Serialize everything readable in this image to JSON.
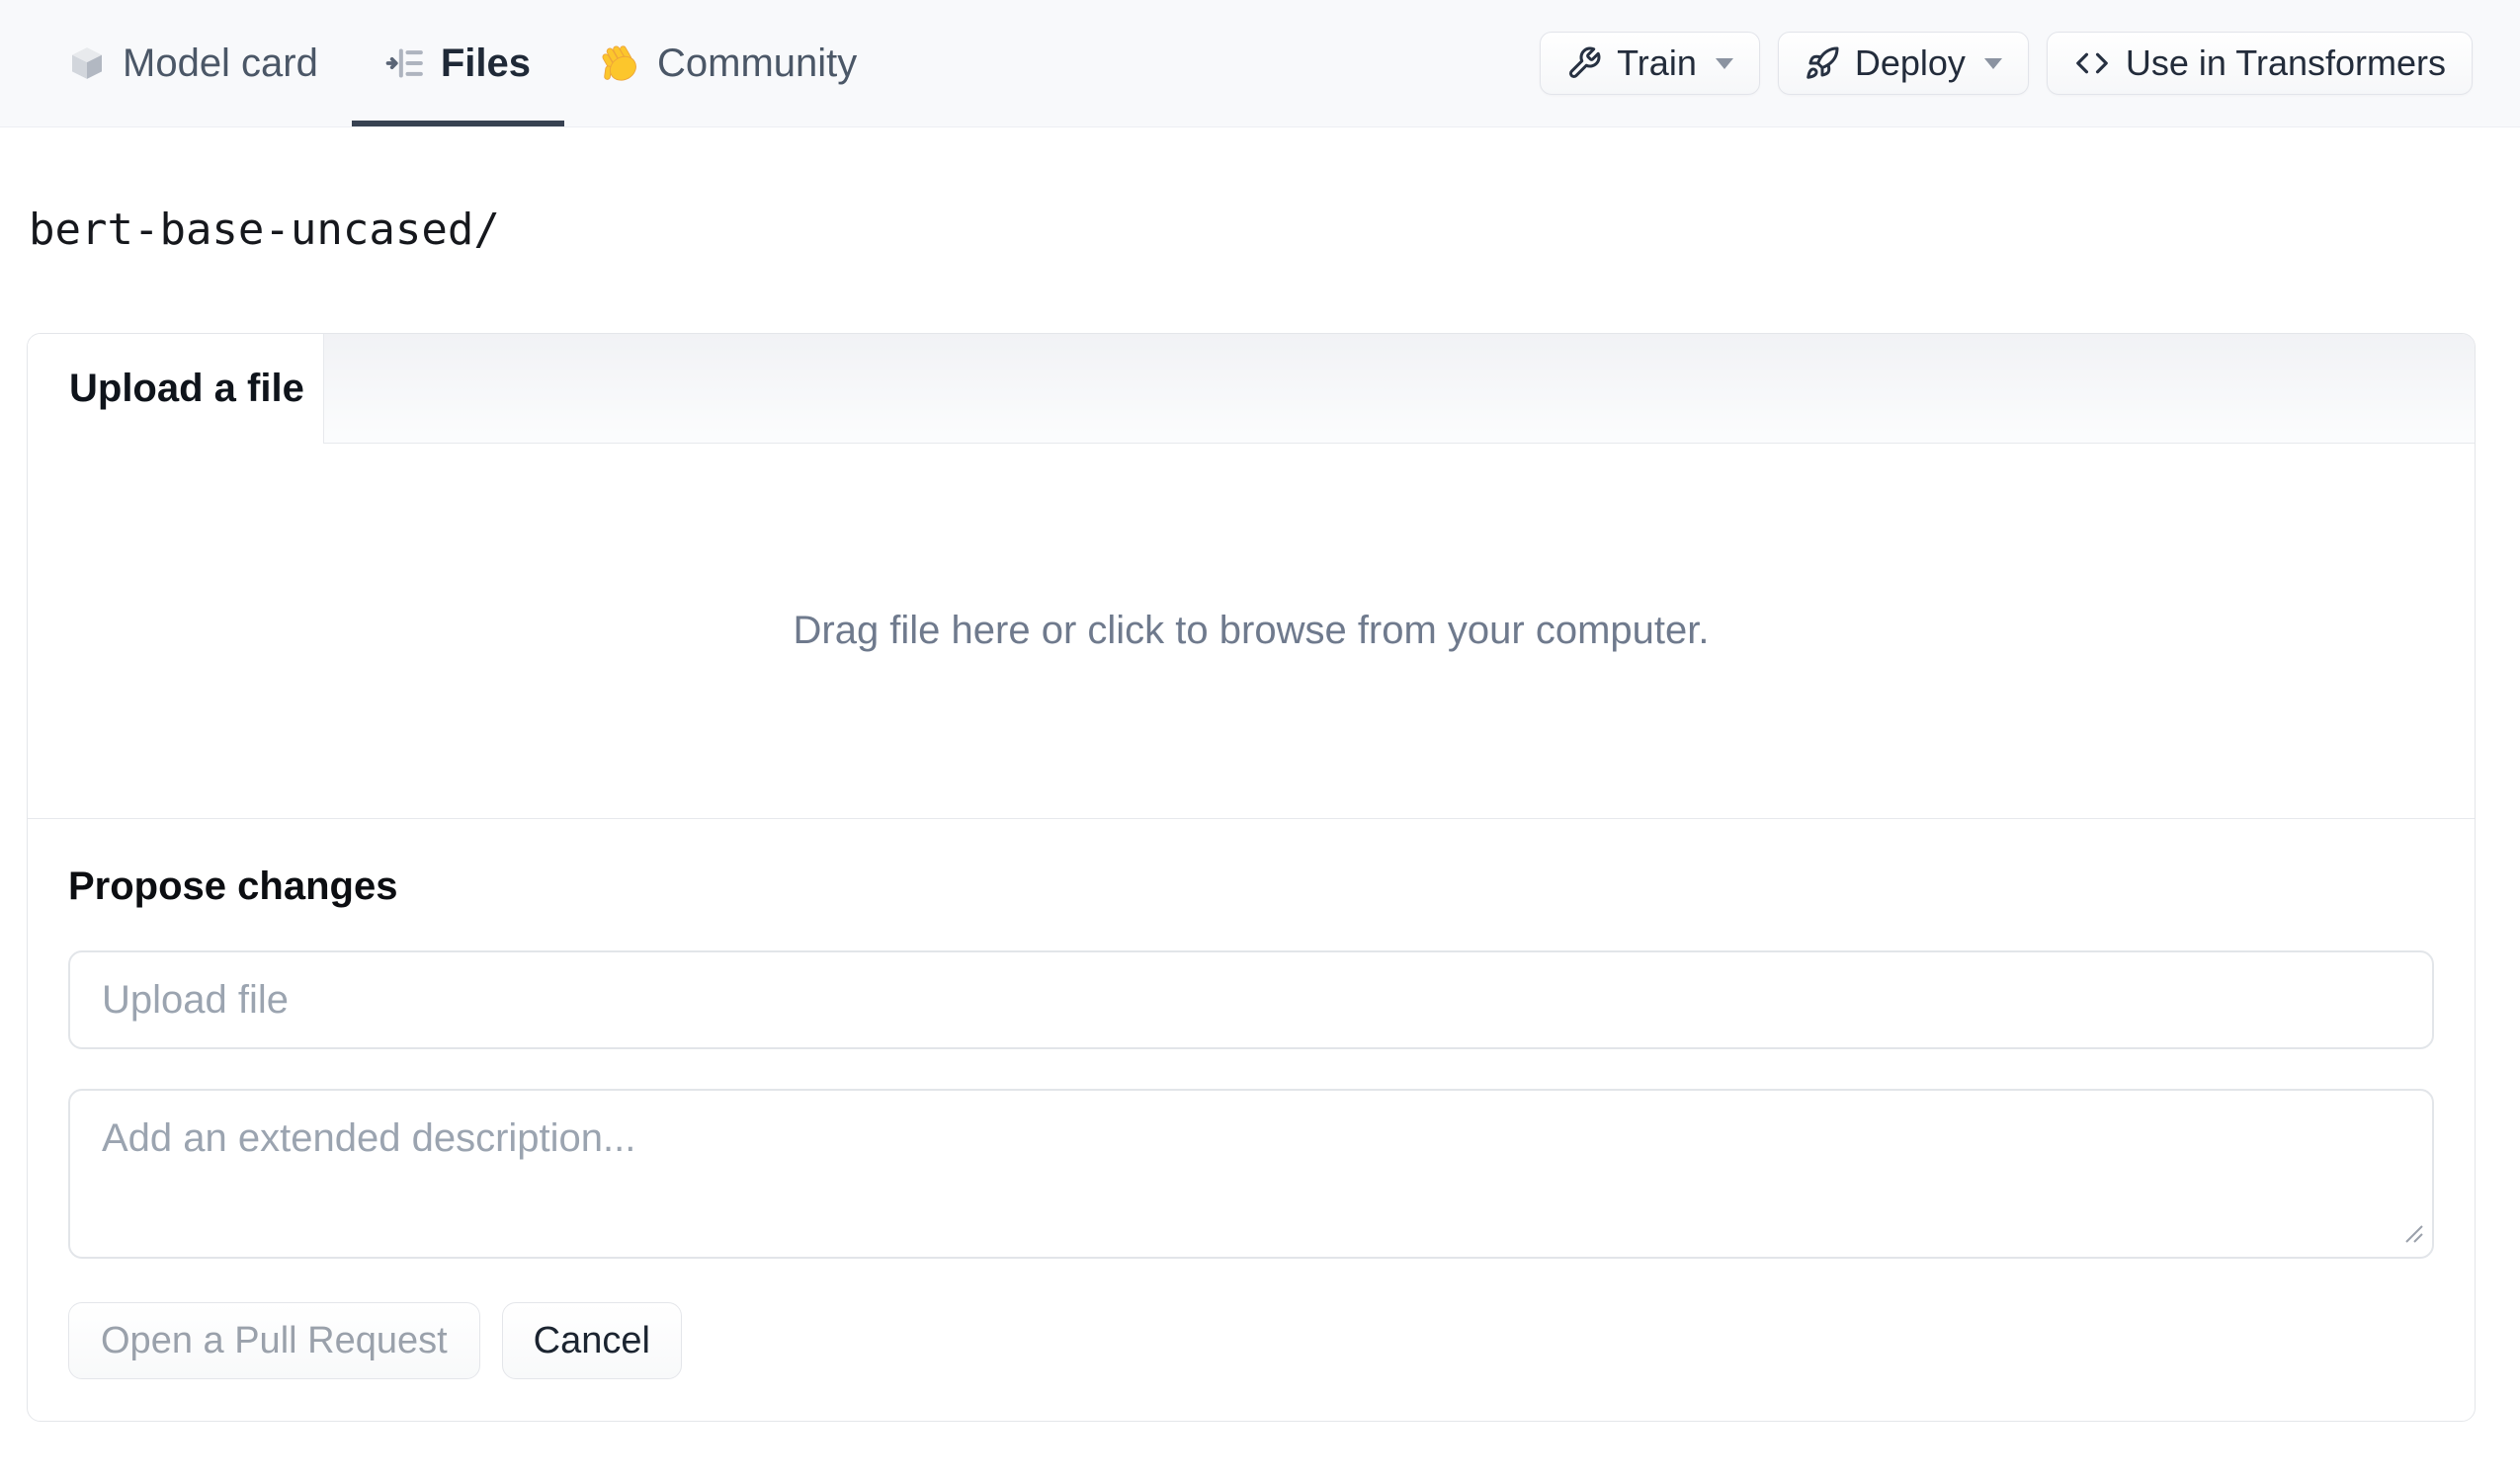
{
  "nav": {
    "tabs": [
      {
        "label": "Model card",
        "icon": "cube-icon",
        "active": false
      },
      {
        "label": "Files",
        "icon": "file-versions-icon",
        "active": true
      },
      {
        "label": "Community",
        "icon": "waving-hand-icon",
        "active": false
      }
    ],
    "actions": [
      {
        "label": "Train",
        "icon": "wrench-icon",
        "has_dropdown": true
      },
      {
        "label": "Deploy",
        "icon": "rocket-icon",
        "has_dropdown": true
      },
      {
        "label": "Use in Transformers",
        "icon": "code-icon",
        "has_dropdown": false
      }
    ]
  },
  "breadcrumb": {
    "path": "bert-base-uncased/"
  },
  "upload_panel": {
    "tab_label": "Upload a file",
    "dropzone_text": "Drag file here or click to browse from your computer.",
    "propose": {
      "heading": "Propose changes",
      "filename_placeholder": "Upload file",
      "filename_value": "",
      "description_placeholder": "Add an extended description...",
      "description_value": "",
      "primary_label": "Open a Pull Request",
      "cancel_label": "Cancel"
    }
  },
  "colors": {
    "navbar_bg": "#f8f9fb",
    "active_tab_underline": "#384252",
    "nav_text": "#4b5767",
    "panel_border": "#e4e6ea",
    "dropzone_text": "#6f7a8d",
    "placeholder": "#9ba4b0",
    "disabled_button_text": "#9aa1ab",
    "hand_emoji_yellow": "#fcc62c"
  }
}
